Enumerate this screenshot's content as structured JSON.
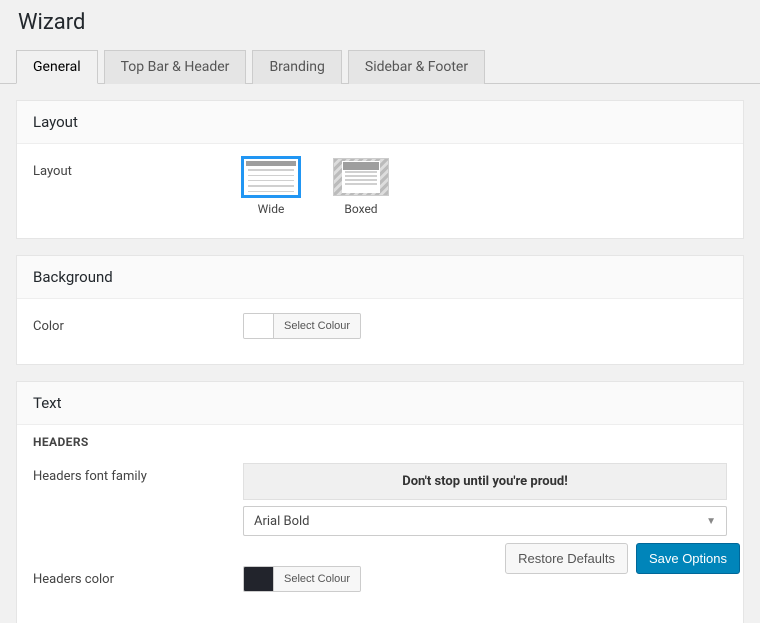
{
  "page_title": "Wizard",
  "tabs": {
    "general": "General",
    "topbar_header": "Top Bar & Header",
    "branding": "Branding",
    "sidebar_footer": "Sidebar & Footer"
  },
  "layout_section": {
    "title": "Layout",
    "field_label": "Layout",
    "options": {
      "wide": "Wide",
      "boxed": "Boxed"
    },
    "selected": "wide"
  },
  "background_section": {
    "title": "Background",
    "color_label": "Color",
    "select_colour_btn": "Select Colour"
  },
  "text_section": {
    "title": "Text",
    "subheading": "HEADERS",
    "font_family_label": "Headers font family",
    "banner": "Don't stop until you're proud!",
    "selected_font": "Arial Bold",
    "headers_color_label": "Headers color",
    "select_colour_btn": "Select Colour",
    "headers_color_value": "#22242c"
  },
  "footer": {
    "restore_defaults": "Restore Defaults",
    "save_options": "Save Options"
  }
}
